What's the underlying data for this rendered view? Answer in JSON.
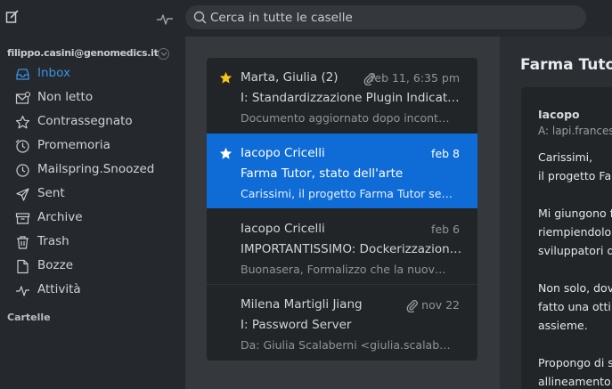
{
  "toolbar": {
    "search_placeholder": "Cerca in tutte le caselle",
    "compose_icon": "compose-icon",
    "activity_icon": "pulse-icon"
  },
  "sidebar": {
    "account": "filippo.casini@genomedics.it",
    "items": [
      {
        "label": "Inbox",
        "icon": "inbox-icon",
        "active": true
      },
      {
        "label": "Non letto",
        "icon": "unread-icon"
      },
      {
        "label": "Contrassegnato",
        "icon": "star-icon"
      },
      {
        "label": "Promemoria",
        "icon": "reminder-icon"
      },
      {
        "label": "Mailspring.Snoozed",
        "icon": "clock-icon"
      },
      {
        "label": "Sent",
        "icon": "send-icon"
      },
      {
        "label": "Archive",
        "icon": "archive-icon"
      },
      {
        "label": "Trash",
        "icon": "trash-icon"
      },
      {
        "label": "Bozze",
        "icon": "draft-icon"
      },
      {
        "label": "Attività",
        "icon": "activity-icon"
      }
    ],
    "section_label": "Cartelle"
  },
  "messages": [
    {
      "from": "Marta, Giulia (2)",
      "date": "feb 11, 6:35 pm",
      "subject": "I: Standardizzazione Plugin Indicator L...",
      "snippet": "Documento aggiornato dopo incontro ...",
      "starred": true,
      "attachment": true,
      "selected": false
    },
    {
      "from": "Iacopo Cricelli",
      "date": "feb 8",
      "subject": "Farma Tutor, stato dell'arte",
      "snippet": "Carissimi, il progetto Farma Tutor semb...",
      "starred": true,
      "attachment": false,
      "selected": true
    },
    {
      "from": "Iacopo Cricelli",
      "date": "feb 6",
      "subject": "IMPORTANTISSIMO: Dockerizzazione ...",
      "snippet": "Buonasera, Formalizzo che la nuova e d...",
      "starred": false,
      "attachment": false,
      "selected": false
    },
    {
      "from": "Milena Martigli Jiang",
      "date": "nov 22",
      "subject": "I: Password Server",
      "snippet": "Da: Giulia Scalaberni <giulia.scalaberni...",
      "starred": false,
      "attachment": true,
      "selected": false
    }
  ],
  "reader": {
    "title": "Farma Tuto",
    "sender": "Iacopo",
    "recipient": "A: lapi.francesc",
    "body_lines": [
      "Carissimi,",
      "il progetto Far",
      "",
      "Mi giungono f",
      "riempiendolo",
      "sviluppatori di",
      "",
      "Non solo, dov",
      "fatto una ottin",
      "assieme.",
      "",
      "Propongo di s",
      "allineamento."
    ]
  },
  "colors": {
    "accent": "#0f6cd6",
    "active_nav": "#3a93e6",
    "star": "#f5c518",
    "sidebar_bg": "#25282c",
    "list_bg": "#35383d"
  }
}
